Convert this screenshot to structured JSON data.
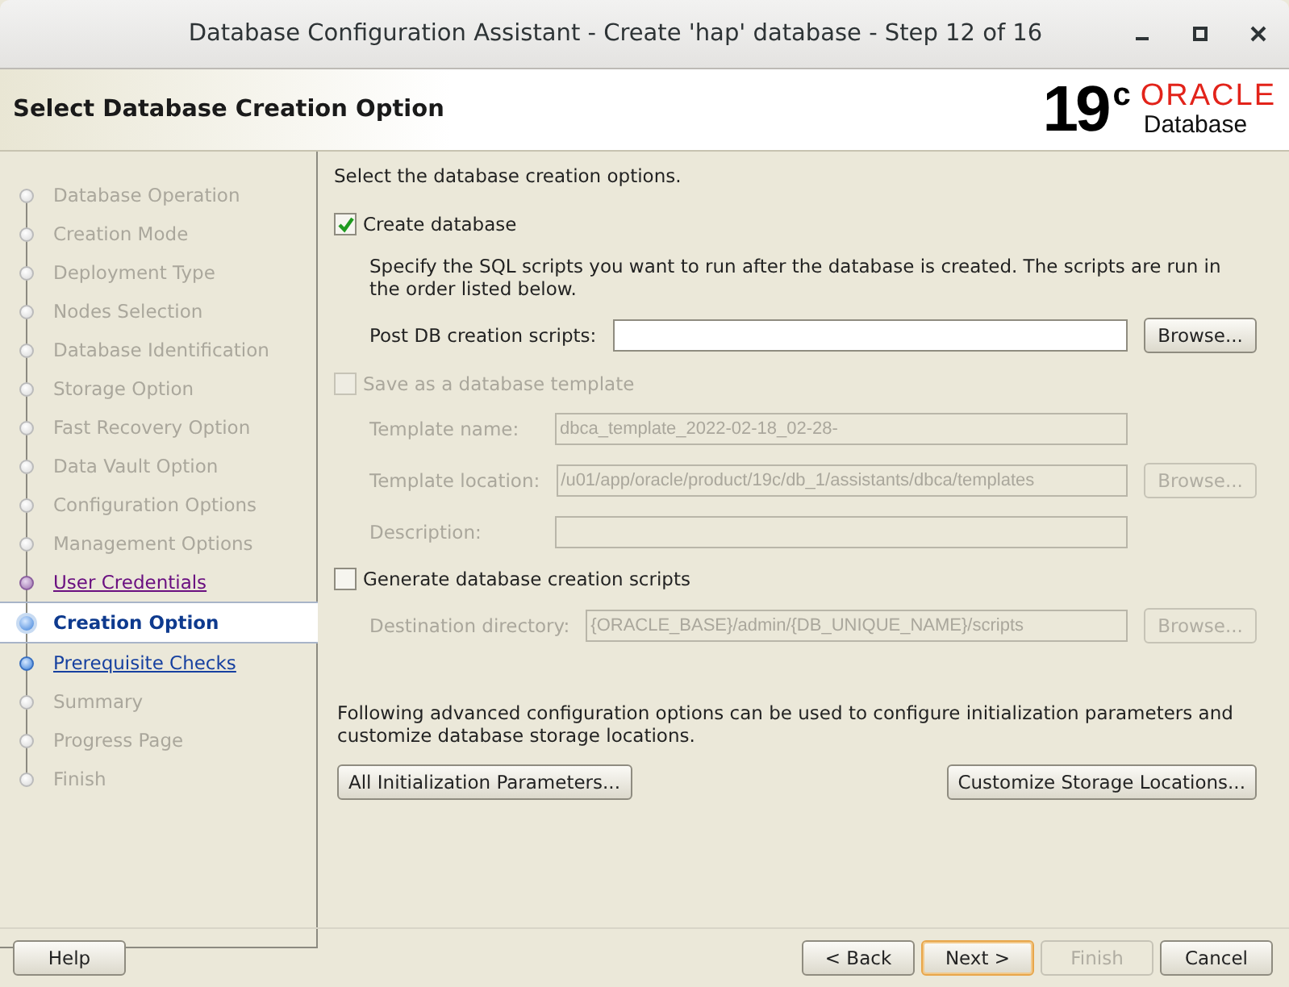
{
  "window": {
    "title": "Database Configuration Assistant - Create 'hap' database - Step 12 of 16"
  },
  "header": {
    "title": "Select Database Creation Option",
    "logo": {
      "version": "19",
      "version_suffix": "c",
      "brand": "ORACLE",
      "product": "Database"
    }
  },
  "steps": [
    {
      "label": "Database Operation",
      "kind": "pending"
    },
    {
      "label": "Creation Mode",
      "kind": "pending"
    },
    {
      "label": "Deployment Type",
      "kind": "pending"
    },
    {
      "label": "Nodes Selection",
      "kind": "pending"
    },
    {
      "label": "Database Identification",
      "kind": "pending"
    },
    {
      "label": "Storage Option",
      "kind": "pending"
    },
    {
      "label": "Fast Recovery Option",
      "kind": "pending"
    },
    {
      "label": "Data Vault Option",
      "kind": "pending"
    },
    {
      "label": "Configuration Options",
      "kind": "pending"
    },
    {
      "label": "Management Options",
      "kind": "pending"
    },
    {
      "label": "User Credentials",
      "kind": "visited"
    },
    {
      "label": "Creation Option",
      "kind": "current"
    },
    {
      "label": "Prerequisite Checks",
      "kind": "next"
    },
    {
      "label": "Summary",
      "kind": "pending"
    },
    {
      "label": "Progress Page",
      "kind": "pending"
    },
    {
      "label": "Finish",
      "kind": "pending"
    }
  ],
  "content": [
    {
      "kind": "text",
      "text": "Select the database creation options."
    },
    {
      "kind": "checkbox",
      "label": "Create database",
      "checked": true,
      "disabled": false
    },
    {
      "kind": "note",
      "text": "Specify the SQL scripts you want to run after the database is created. The scripts are run in the order listed below."
    },
    {
      "kind": "field",
      "label": "Post DB creation scripts:",
      "disabled": false,
      "button": "Browse..."
    },
    {
      "kind": "checkbox",
      "label": "Save as a database template",
      "checked": false,
      "disabled": true
    },
    {
      "kind": "field",
      "label": "Template name:",
      "value": "dbca_template_2022-02-18_02-28-",
      "disabled": true
    },
    {
      "kind": "field",
      "label": "Template location:",
      "value": "/u01/app/oracle/product/19c/db_1/assistants/dbca/templates",
      "disabled": true,
      "button": "Browse..."
    },
    {
      "kind": "field",
      "label": "Description:",
      "disabled": true
    },
    {
      "kind": "checkbox",
      "label": "Generate database creation scripts",
      "checked": false,
      "disabled": false
    },
    {
      "kind": "field",
      "label": "Destination directory:",
      "value": "{ORACLE_BASE}/admin/{DB_UNIQUE_NAME}/scripts",
      "disabled": true,
      "button": "Browse..."
    }
  ],
  "advanced": {
    "text": "Following advanced configuration options can be used to configure initialization parameters and customize database storage locations.",
    "buttons": [
      "All Initialization Parameters...",
      "Customize Storage Locations..."
    ]
  },
  "footer": {
    "help": "Help",
    "buttons": [
      {
        "label": "< Back",
        "disabled": false,
        "selected": false
      },
      {
        "label": "Next >",
        "disabled": false,
        "selected": true
      },
      {
        "label": "Finish",
        "disabled": true,
        "selected": false
      },
      {
        "label": "Cancel",
        "disabled": false,
        "selected": false
      }
    ]
  }
}
